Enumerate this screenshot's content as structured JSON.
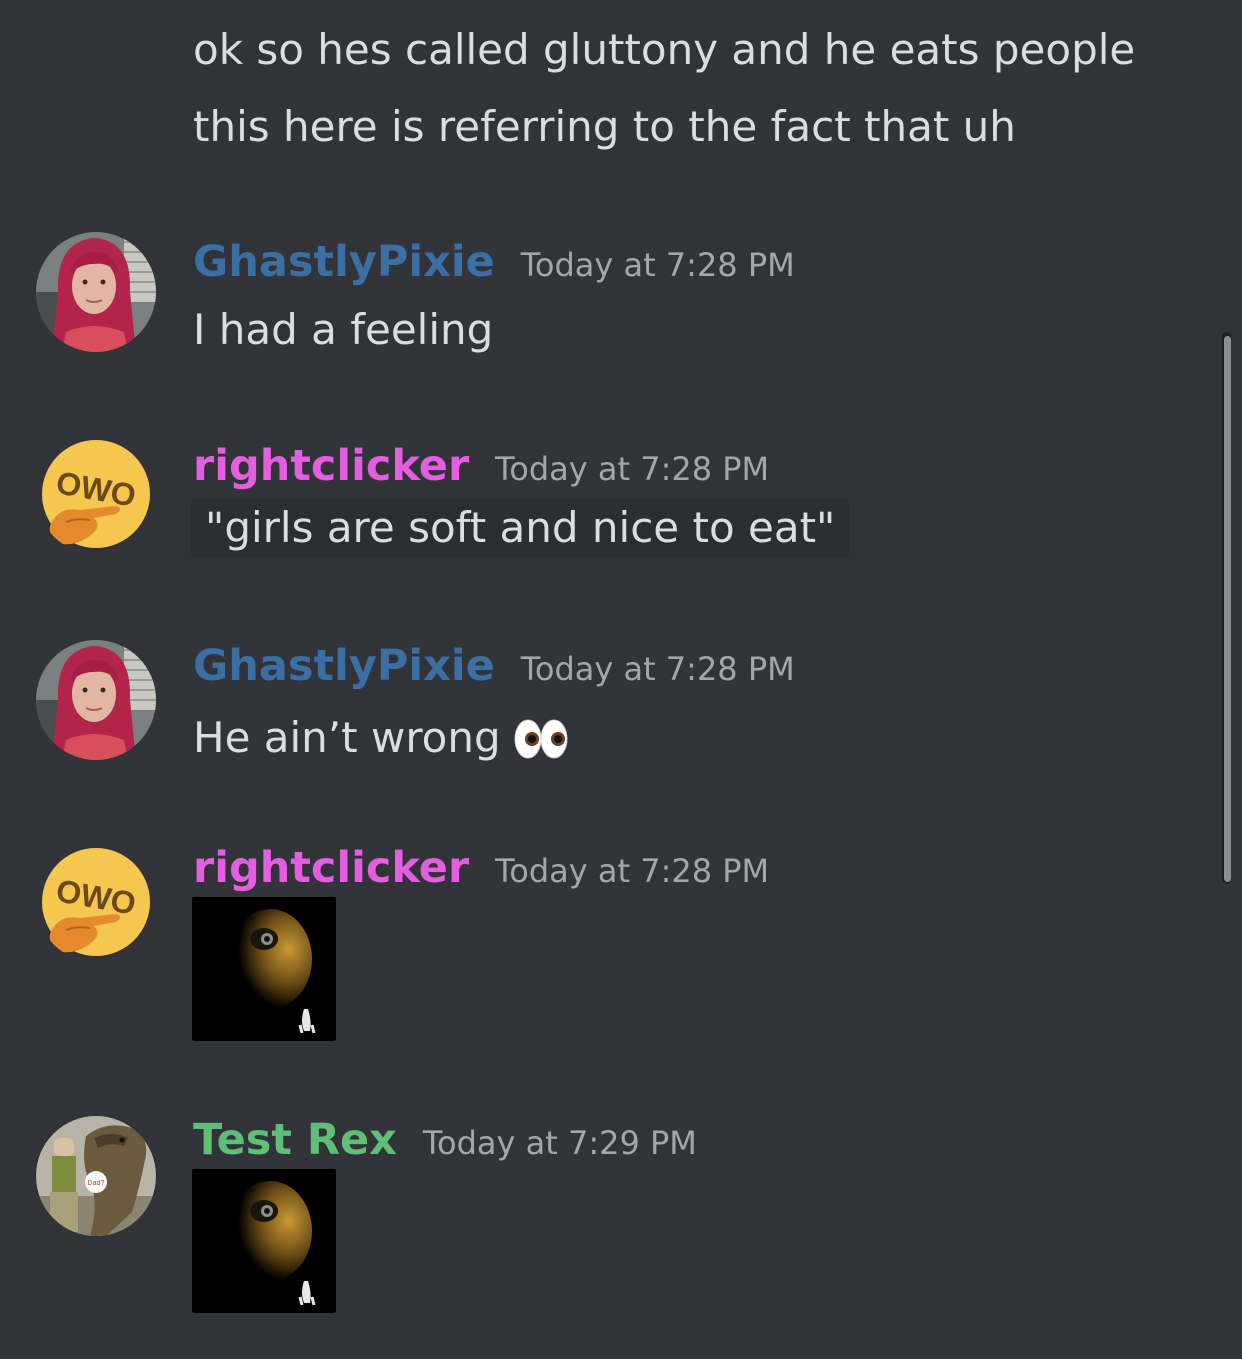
{
  "colors": {
    "background": "#313338",
    "message_text": "#dbdee1",
    "timestamp": "#a3a6aa",
    "ghastlypixie": "#3b6ea3",
    "rightclicker": "#e35ee0",
    "test_rex": "#5fbf76",
    "code_background": "#2b2d31"
  },
  "messages": [
    {
      "text_lines": [
        "ok so hes called gluttony and he eats people",
        "this here is referring to the fact that uh"
      ]
    },
    {
      "username": "GhastlyPixie",
      "timestamp": "Today at 7:28 PM",
      "avatar": "photo-avatar-pink-hair",
      "text": "I had a feeling"
    },
    {
      "username": "rightclicker",
      "timestamp": "Today at 7:28 PM",
      "avatar": "owo-pointing-emoji-avatar",
      "code_text": "\"girls are soft and nice to eat\""
    },
    {
      "username": "GhastlyPixie",
      "timestamp": "Today at 7:28 PM",
      "avatar": "photo-avatar-pink-hair",
      "text": "He ain’t wrong",
      "emoji": "eyes-emoji"
    },
    {
      "username": "rightclicker",
      "timestamp": "Today at 7:28 PM",
      "avatar": "owo-pointing-emoji-avatar",
      "attachment": "dark-moon-face-image"
    },
    {
      "username": "Test Rex",
      "timestamp": "Today at 7:29 PM",
      "avatar": "dinosaur-soldier-avatar",
      "avatar_sticker_text": "Dad?",
      "attachment": "dark-moon-face-image"
    }
  ]
}
